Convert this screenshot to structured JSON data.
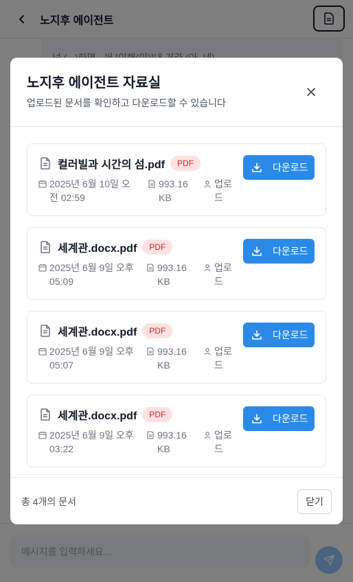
{
  "header": {
    "title": "노지후 에이전트"
  },
  "background_message": "넌 (...)하면...써 [이해(이)]내 거라 (아, 네)",
  "input": {
    "placeholder": "메시지를 입력하세요..."
  },
  "modal": {
    "title": "노지후 에이전트 자료실",
    "subtitle": "업로드된 문서를 확인하고 다운로드할 수 있습니다",
    "documents": [
      {
        "name": "컬러빌과 시간의 섬.pdf",
        "type": "PDF",
        "date": "2025년 6월 10일 오전 02:59",
        "size": "993.16 KB",
        "uploader": "업로드",
        "download_label": "다운로드"
      },
      {
        "name": "세계관.docx.pdf",
        "type": "PDF",
        "date": "2025년 6월 9일 오후 05:09",
        "size": "993.16 KB",
        "uploader": "업로드",
        "download_label": "다운로드"
      },
      {
        "name": "세계관.docx.pdf",
        "type": "PDF",
        "date": "2025년 6월 9일 오후 05:07",
        "size": "993.16 KB",
        "uploader": "업로드",
        "download_label": "다운로드"
      },
      {
        "name": "세계관.docx.pdf",
        "type": "PDF",
        "date": "2025년 6월 9일 오후 03:22",
        "size": "993.16 KB",
        "uploader": "업로드",
        "download_label": "다운로드"
      }
    ],
    "footer": {
      "count_text": "총 4개의 문서",
      "close_label": "닫기"
    }
  },
  "colors": {
    "primary": "#2b8ae8",
    "badge_bg": "#fee2e2",
    "badge_text": "#dc2626",
    "overlay": "rgba(0,0,0,0.5)"
  },
  "icons": [
    "chevron-left-icon",
    "document-icon",
    "close-icon",
    "file-icon",
    "calendar-icon",
    "file-size-icon",
    "user-icon",
    "download-icon",
    "send-icon"
  ]
}
